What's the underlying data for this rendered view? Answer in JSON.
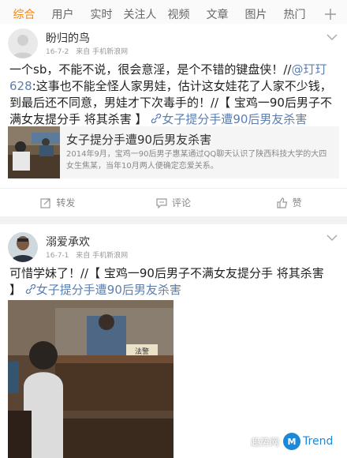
{
  "tabs": [
    "综合",
    "用户",
    "实时",
    "关注人",
    "视频",
    "文章",
    "图片",
    "热门"
  ],
  "active_tab": "综合",
  "posts": [
    {
      "username": "盼归的鸟",
      "date": "16-7-2",
      "source": "来自 手机新浪网",
      "text_part1": "一个sb，不能不说，很会意淫，是个不错的键盘侠！//",
      "mention": "@玎玎628",
      "text_part2": ":这事也不能全怪人家男娃，估计这女娃花了人家不少钱，到最后还不同意，男娃才下次毒手的！//【 宝鸡一90后男子不满女友提分手 将其杀害 】",
      "link": "女子提分手遭90后男友杀害",
      "share": {
        "title": "女子提分手遭90后男友杀害",
        "description": "2014年9月，宝鸡一90后男子惠某通过QQ聊天认识了陕西科技大学的大四女生焦某，当年10月两人便确定恋爱关系。"
      },
      "actions": {
        "repost": "转发",
        "comment": "评论",
        "like": "赞"
      }
    },
    {
      "username": "溺爱承欢",
      "date": "16-7-1",
      "source": "来自 手机新浪网",
      "text": "可惜学妹了！//【 宝鸡一90后男子不满女友提分手 将其杀害 】",
      "link": "女子提分手遭90后男友杀害",
      "photo_sign": "法警"
    }
  ],
  "watermark": {
    "text": "趋势网",
    "brand": "Trend",
    "logo_letter": "M"
  },
  "colors": {
    "accent": "#ff8200",
    "link": "#5b7fb0",
    "watermark_blue": "#1e88d8"
  }
}
